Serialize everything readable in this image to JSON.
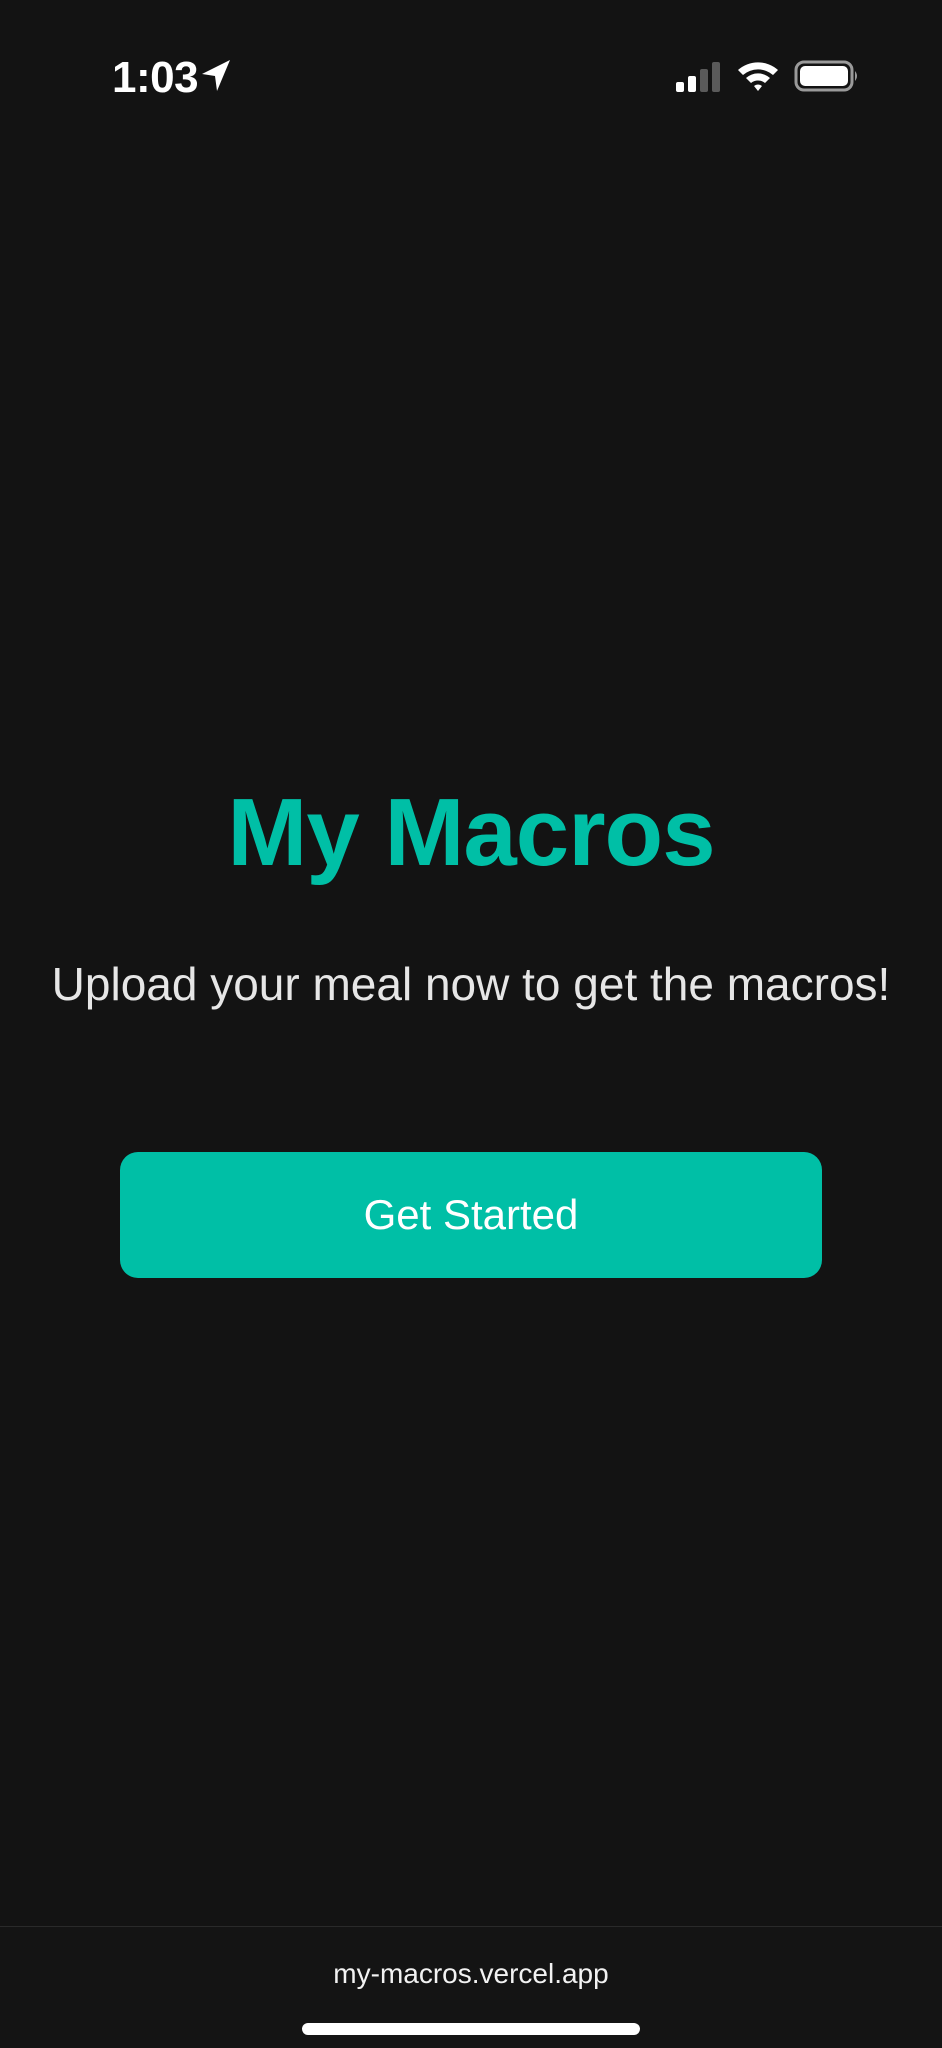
{
  "status_bar": {
    "time": "1:03",
    "icons": [
      "location-arrow-icon",
      "cellular-signal-icon",
      "wifi-icon",
      "battery-icon"
    ]
  },
  "main": {
    "title": "My Macros",
    "subtitle": "Upload your meal now to get the macros!",
    "cta_label": "Get Started"
  },
  "browser_bar": {
    "url": "my-macros.vercel.app"
  },
  "colors": {
    "background": "#131313",
    "accent": "#00bfa6",
    "text_primary": "#ffffff",
    "text_secondary": "#e6e6e6"
  }
}
